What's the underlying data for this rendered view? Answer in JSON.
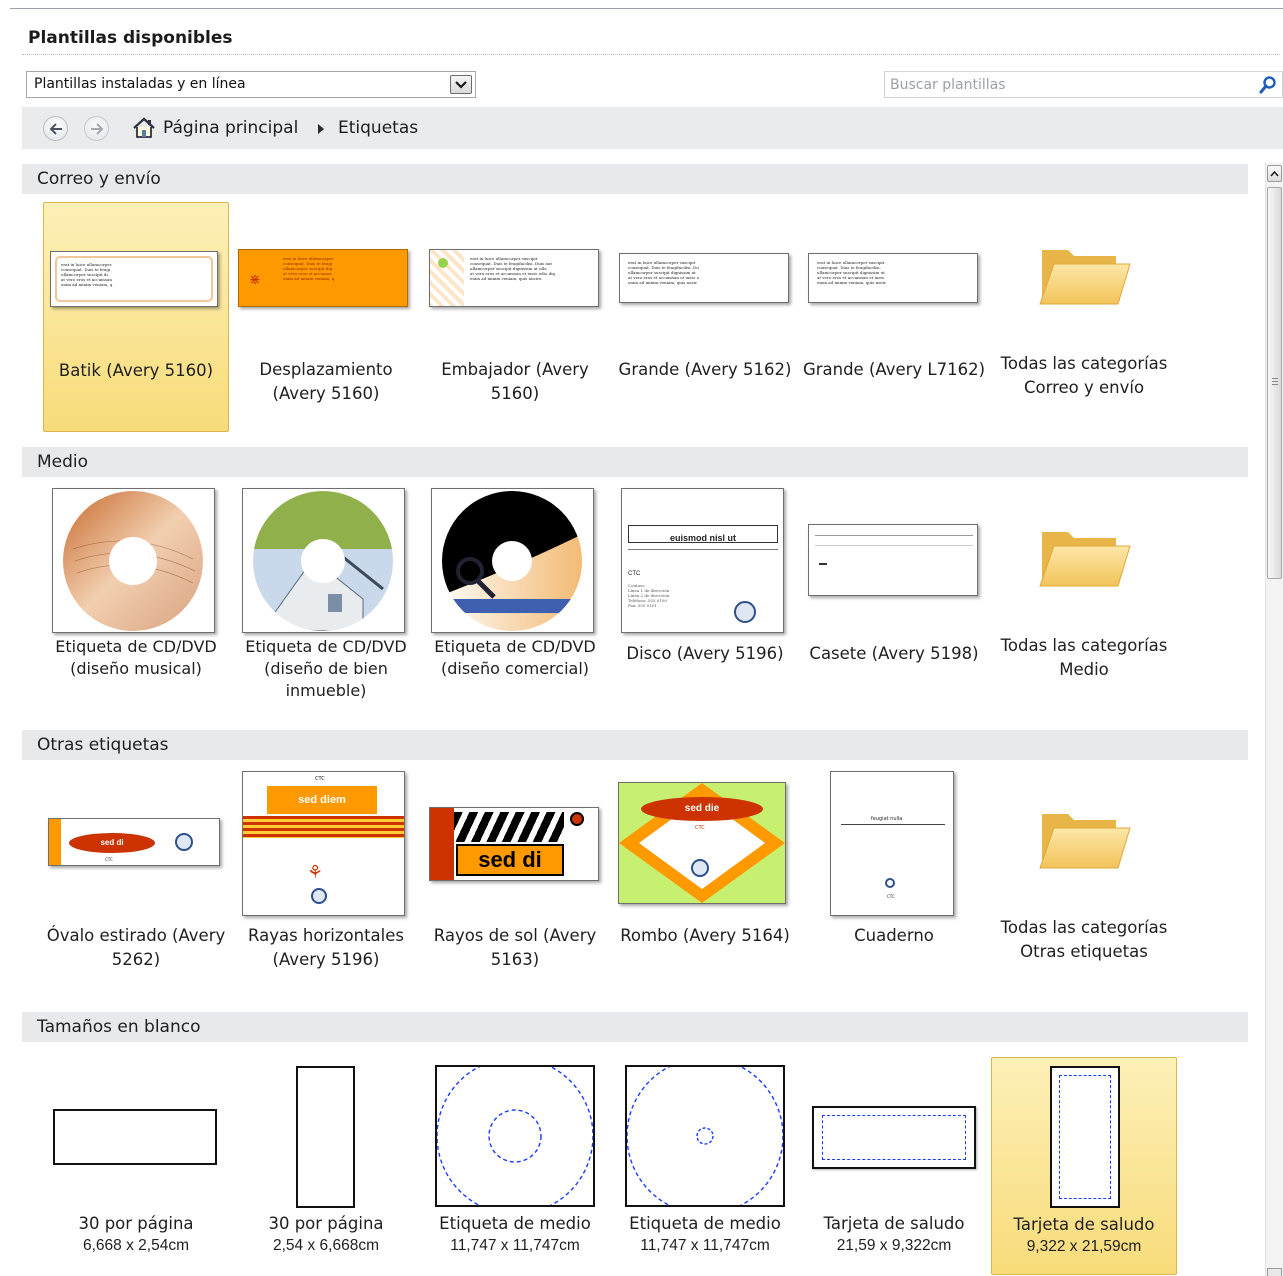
{
  "header": {
    "title": "Plantillas disponibles"
  },
  "filter": {
    "selected": "Plantillas instaladas y en línea"
  },
  "search": {
    "placeholder": "Buscar plantillas"
  },
  "breadcrumb": {
    "home": "Página principal",
    "current": "Etiquetas"
  },
  "sections": [
    {
      "title": "Correo y envío",
      "items": [
        {
          "label": "Batik (Avery 5160)",
          "selected": true
        },
        {
          "label": "Desplazamiento (Avery 5160)"
        },
        {
          "label": "Embajador (Avery 5160)"
        },
        {
          "label": "Grande (Avery 5162)"
        },
        {
          "label": "Grande (Avery L7162)"
        },
        {
          "label": "Todas las categorías Correo y envío"
        }
      ]
    },
    {
      "title": "Medio",
      "items": [
        {
          "label": "Etiqueta de CD/DVD (diseño musical)"
        },
        {
          "label": "Etiqueta de CD/DVD (diseño de bien inmueble)"
        },
        {
          "label": "Etiqueta de CD/DVD (diseño comercial)"
        },
        {
          "label": "Disco (Avery 5196)",
          "thumb_text": [
            "euismod nisl ut",
            "CTC"
          ]
        },
        {
          "label": "Casete (Avery 5198)"
        },
        {
          "label": "Todas las categorías Medio"
        }
      ]
    },
    {
      "title": "Otras etiquetas",
      "items": [
        {
          "label": "Óvalo estirado (Avery 5262)",
          "thumb_text": [
            "sed di",
            "CTC"
          ]
        },
        {
          "label": "Rayas horizontales (Avery 5196)",
          "thumb_text": [
            "sed diem",
            "CTC"
          ]
        },
        {
          "label": "Rayos de sol (Avery 5163)",
          "thumb_text": [
            "sed di"
          ]
        },
        {
          "label": "Rombo (Avery 5164)",
          "thumb_text": [
            "sed die",
            "CTC"
          ]
        },
        {
          "label": "Cuaderno",
          "thumb_text": [
            "feugiat nulla",
            "CTC"
          ]
        },
        {
          "label": "Todas las categorías Otras etiquetas"
        }
      ]
    },
    {
      "title": "Tamaños en blanco",
      "items": [
        {
          "label": "30 por página",
          "size": "6,668 x 2,54cm"
        },
        {
          "label": "30 por página",
          "size": "2,54 x 6,668cm"
        },
        {
          "label": "Etiqueta de medio",
          "size": "11,747 x 11,747cm"
        },
        {
          "label": "Etiqueta de medio",
          "size": "11,747 x 11,747cm"
        },
        {
          "label": "Tarjeta de saludo",
          "size": "21,59 x 9,322cm"
        },
        {
          "label": "Tarjeta de saludo",
          "size": "9,322 x 21,59cm",
          "selected": true
        }
      ]
    }
  ],
  "colors": {
    "selection": "#f8dc7a",
    "section_bg": "#e8e9ea",
    "accent_orange": "#ff9900",
    "accent_red": "#cc3300",
    "blank_dash": "#1a3cff"
  },
  "icons": [
    "chevron-down-icon",
    "search-icon",
    "back-arrow-icon",
    "forward-arrow-icon",
    "home-icon",
    "folder-icon"
  ]
}
